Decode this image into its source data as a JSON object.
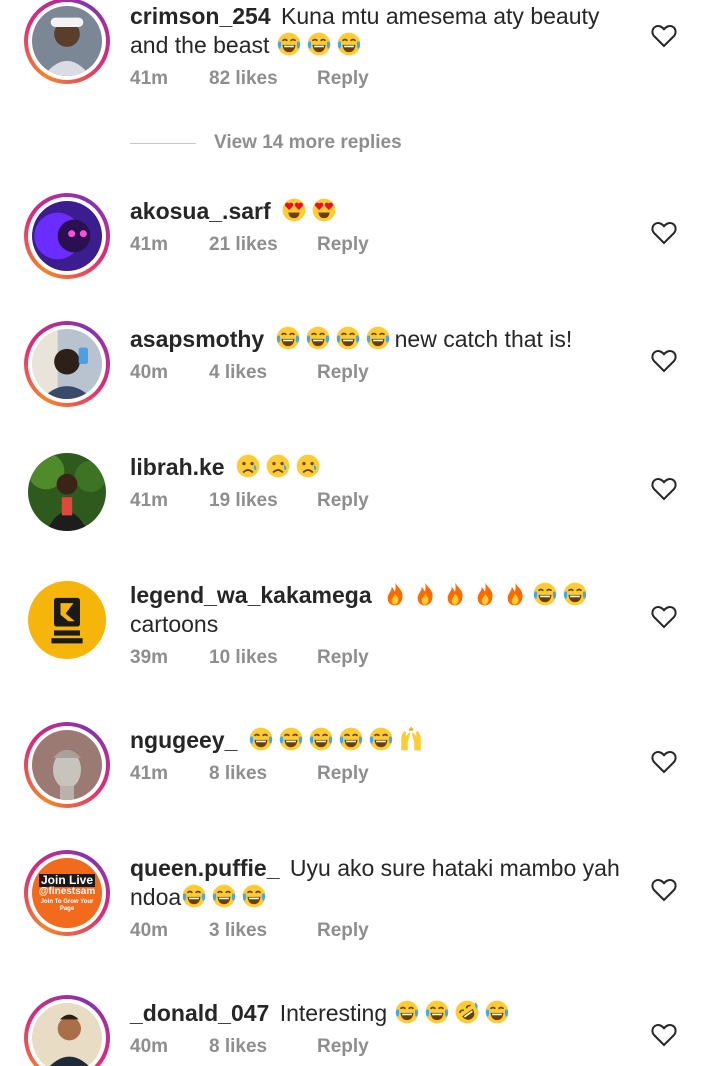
{
  "comments": [
    {
      "username": "crimson_254",
      "text": "Kuna mtu amesema aty beauty and the beast",
      "emojis": [
        "joy",
        "joy",
        "joy"
      ],
      "time": "41m",
      "likes": "82 likes",
      "reply": "Reply"
    },
    {
      "username": "akosua_.sarf",
      "text": "",
      "emojis": [
        "heart-eyes",
        "heart-eyes"
      ],
      "time": "41m",
      "likes": "21 likes",
      "reply": "Reply"
    },
    {
      "username": "asapsmothy",
      "text": "new catch that is!",
      "emojis": [
        "joy",
        "joy",
        "joy",
        "joy"
      ],
      "time": "40m",
      "likes": "4 likes",
      "reply": "Reply"
    },
    {
      "username": "librah.ke",
      "text": "",
      "emojis": [
        "sad",
        "sad",
        "sad"
      ],
      "time": "41m",
      "likes": "19 likes",
      "reply": "Reply"
    },
    {
      "username": "legend_wa_kakamega",
      "text": "cartoons",
      "emojis": [
        "fire",
        "fire",
        "fire",
        "fire",
        "fire",
        "joy",
        "joy"
      ],
      "time": "39m",
      "likes": "10 likes",
      "reply": "Reply"
    },
    {
      "username": "ngugeey_",
      "text": "",
      "emojis": [
        "joy",
        "joy",
        "joy",
        "joy",
        "joy",
        "raised-hands"
      ],
      "time": "41m",
      "likes": "8 likes",
      "reply": "Reply"
    },
    {
      "username": "queen.puffie_",
      "text": "Uyu ako sure hataki mambo yah ndoa",
      "emojis": [
        "joy",
        "joy",
        "joy"
      ],
      "time": "40m",
      "likes": "3 likes",
      "reply": "Reply"
    },
    {
      "username": "_donald_047",
      "text": "Interesting",
      "emojis": [
        "joy",
        "joy",
        "rofl",
        "joy"
      ],
      "time": "40m",
      "likes": "8 likes",
      "reply": "Reply"
    }
  ],
  "more_replies": "View 14 more replies",
  "avatar_badge": {
    "line1": "Join Live",
    "line2": "@finestsam",
    "line3": "Join To Grow Your",
    "line4": "Page"
  },
  "colors": {
    "like_heart": "#262626",
    "meta": "#8e8e8e",
    "ring_start": "#f58529",
    "ring_mid": "#dd2a7b"
  },
  "icons": [
    "heart-outline-icon",
    "emoji-icon"
  ]
}
